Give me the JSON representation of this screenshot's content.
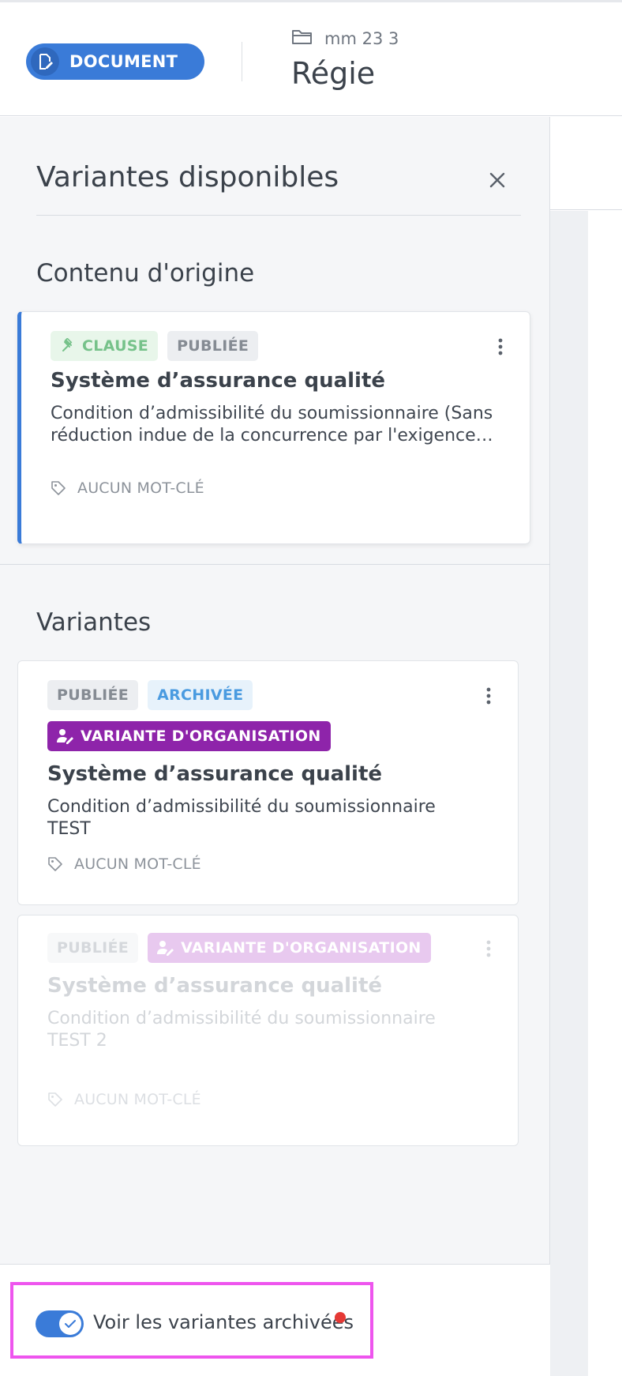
{
  "header": {
    "doc_label": "DOCUMENT",
    "folder": "mm 23 3",
    "title": "Régie"
  },
  "panel": {
    "title": "Variantes disponibles",
    "section_original": "Contenu d'origine",
    "section_variants": "Variantes"
  },
  "original_card": {
    "tags": [
      "CLAUSE",
      "PUBLIÉE"
    ],
    "title": "Système d’assurance qualité",
    "description": "Condition d’admissibilité du soumissionnaire (Sans réduction indue de la concurrence par l'exigence…",
    "keywords": "AUCUN MOT-CLÉ"
  },
  "variants": [
    {
      "tags": [
        "PUBLIÉE",
        "ARCHIVÉE"
      ],
      "org_tag": "VARIANTE D'ORGANISATION",
      "title": "Système d’assurance qualité",
      "description": "Condition d’admissibilité du soumissionnaire TEST",
      "keywords": "AUCUN MOT-CLÉ"
    },
    {
      "tags": [
        "PUBLIÉE"
      ],
      "org_tag": "VARIANTE D'ORGANISATION",
      "title": "Système d’assurance qualité",
      "description": "Condition d’admissibilité du soumissionnaire TEST 2",
      "keywords": "AUCUN MOT-CLÉ"
    }
  ],
  "footer": {
    "toggle_label": "Voir les variantes archivées",
    "toggle_on": true
  },
  "colors": {
    "accent": "#3a7bd8",
    "org_tag": "#8e24aa",
    "clause_green": "#76c28a",
    "archived_blue": "#4a9be0",
    "highlight": "#ee55ee",
    "notification_dot": "#e53935"
  },
  "icons": {
    "doc_pill": "document-edit-icon",
    "folder": "folder-icon",
    "close": "close-icon",
    "clause": "gavel-icon",
    "menu": "kebab-menu-icon",
    "keyword": "tag-icon",
    "org": "user-edit-icon",
    "toggle": "check-icon"
  }
}
